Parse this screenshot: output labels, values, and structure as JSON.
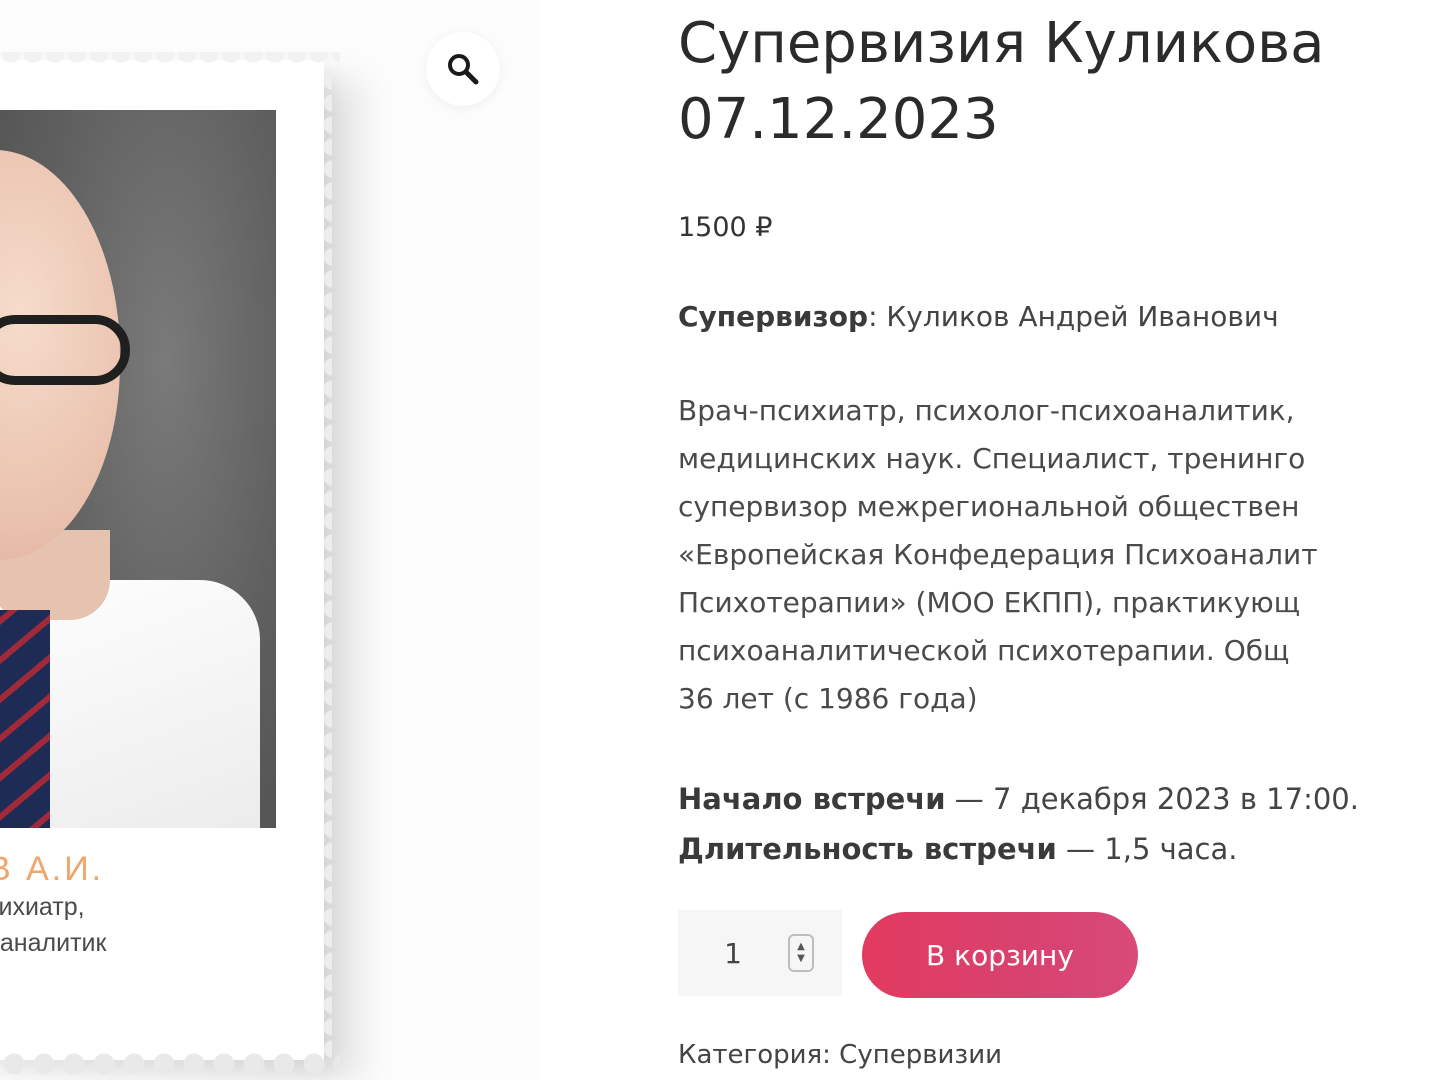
{
  "gallery": {
    "zoom_icon": "magnifier-icon",
    "caption": {
      "name": "В А.И.",
      "line1": "сихиатр,",
      "line2": "оаналитик"
    }
  },
  "product": {
    "title_line1": "Супервизия Куликова",
    "title_line2": "07.12.2023",
    "price": "1500 ₽",
    "supervisor_label": "Супервизор",
    "supervisor_sep": ": ",
    "supervisor_name": "Куликов Андрей Иванович",
    "bio_lines": [
      "Врач-психиатр, психолог-психоаналитик,",
      "медицинских наук. Специалист, тренинго",
      "супервизор межрегиональной обществен",
      "«Европейская Конфедерация Психоаналит",
      "Психотерапии» (МОО ЕКПП), практикующ",
      "психоаналитической психотерапии. Общ",
      "36 лет (с 1986 года)"
    ],
    "meeting_start_label": "Начало встречи",
    "meeting_start_value": " — 7 декабря 2023 в 17:00.",
    "meeting_duration_label": "Длительность встречи",
    "meeting_duration_value": " — 1,5 часа.",
    "quantity": "1",
    "add_to_cart": "В корзину",
    "category_label": "Категория: ",
    "category_value": "Супервизии"
  },
  "colors": {
    "accent_button": "#e23a5f",
    "caption_name": "#f0a56a"
  }
}
